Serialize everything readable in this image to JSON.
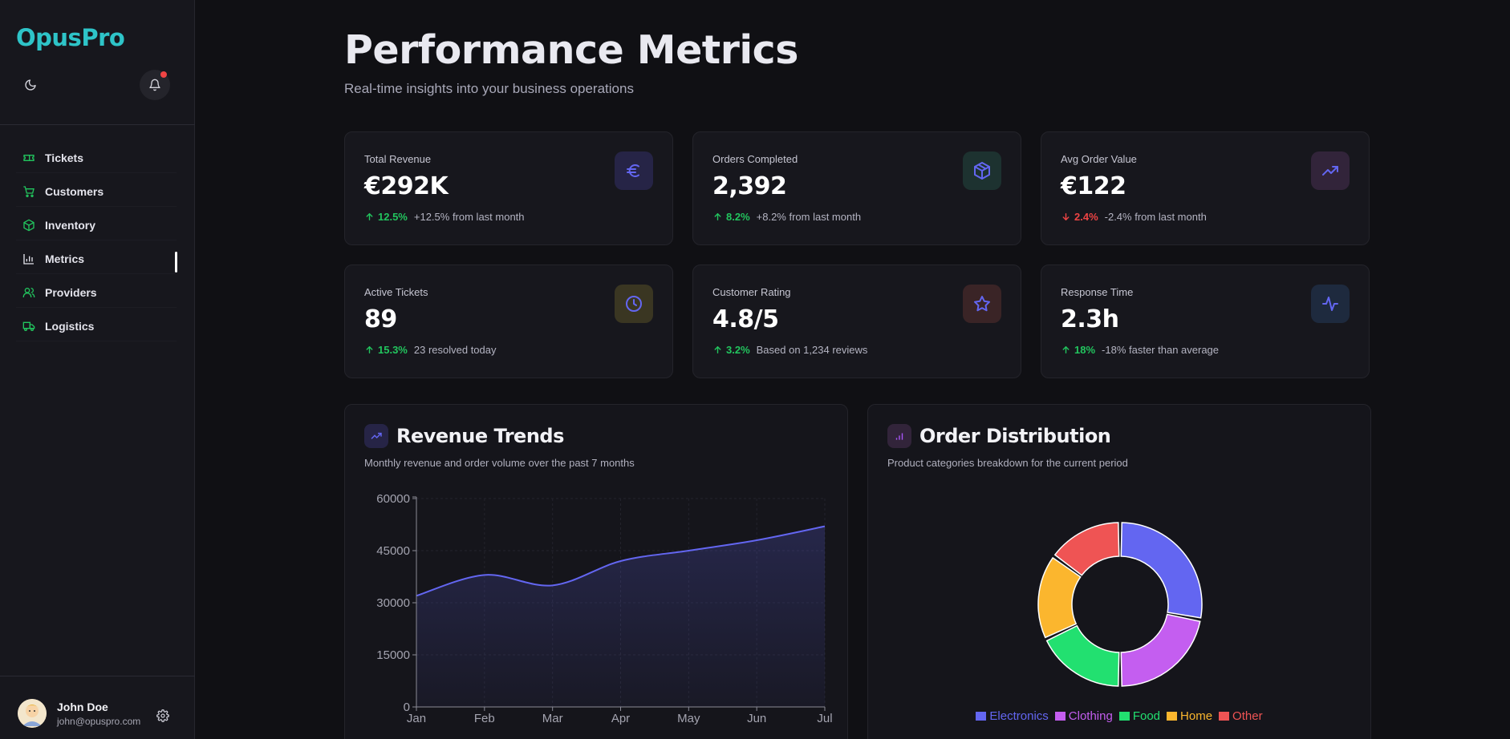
{
  "brand": "OpusPro",
  "nav": [
    {
      "label": "Tickets",
      "icon": "ticket-icon"
    },
    {
      "label": "Customers",
      "icon": "cart-icon"
    },
    {
      "label": "Inventory",
      "icon": "box-icon"
    },
    {
      "label": "Metrics",
      "icon": "bar-chart-icon",
      "active": true
    },
    {
      "label": "Providers",
      "icon": "users-icon"
    },
    {
      "label": "Logistics",
      "icon": "truck-icon"
    }
  ],
  "user": {
    "name": "John Doe",
    "email": "john@opuspro.com"
  },
  "header": {
    "title": "Performance Metrics",
    "subtitle": "Real-time insights into your business operations"
  },
  "cards": [
    {
      "label": "Total Revenue",
      "value": "€292K",
      "pct": "12.5%",
      "note": "+12.5% from last month",
      "trend": "up",
      "icon": "euro-icon",
      "icon_color": "#6366f1",
      "icon_bg": "#262446"
    },
    {
      "label": "Orders Completed",
      "value": "2,392",
      "pct": "8.2%",
      "note": "+8.2% from last month",
      "trend": "up",
      "icon": "package-icon",
      "icon_color": "#6366f1",
      "icon_bg": "#1d3230"
    },
    {
      "label": "Avg Order Value",
      "value": "€122",
      "pct": "2.4%",
      "note": "-2.4% from last month",
      "trend": "down",
      "icon": "trending-up-icon",
      "icon_color": "#6366f1",
      "icon_bg": "#32243a"
    },
    {
      "label": "Active Tickets",
      "value": "89",
      "pct": "15.3%",
      "note": "23 resolved today",
      "trend": "up",
      "icon": "clock-icon",
      "icon_color": "#6366f1",
      "icon_bg": "#3a3622"
    },
    {
      "label": "Customer Rating",
      "value": "4.8/5",
      "pct": "3.2%",
      "note": "Based on 1,234 reviews",
      "trend": "up",
      "icon": "star-icon",
      "icon_color": "#6366f1",
      "icon_bg": "#3a2426"
    },
    {
      "label": "Response Time",
      "value": "2.3h",
      "pct": "18%",
      "note": "-18% faster than average",
      "trend": "up",
      "icon": "activity-icon",
      "icon_color": "#6366f1",
      "icon_bg": "#1e2a3e"
    }
  ],
  "panels": {
    "revenue": {
      "title": "Revenue Trends",
      "subtitle": "Monthly revenue and order volume over the past 7 months"
    },
    "orders": {
      "title": "Order Distribution",
      "subtitle": "Product categories breakdown for the current period"
    }
  },
  "chart_data": [
    {
      "type": "area",
      "x": [
        "Jan",
        "Feb",
        "Mar",
        "Apr",
        "May",
        "Jun",
        "Jul"
      ],
      "series": [
        {
          "values": [
            32000,
            38000,
            35000,
            42000,
            45000,
            48000,
            52000
          ]
        }
      ],
      "yticks": [
        0,
        15000,
        30000,
        45000,
        60000
      ],
      "ylim": [
        0,
        60000
      ],
      "color": "#6366f1"
    },
    {
      "type": "pie",
      "donut": true,
      "categories": [
        "Electronics",
        "Clothing",
        "Food",
        "Home",
        "Other"
      ],
      "values": [
        28,
        22,
        18,
        17,
        15
      ],
      "colors": [
        "#6366f1",
        "#c45ef0",
        "#22e070",
        "#fbb62e",
        "#ef5454"
      ],
      "legend": "bottom"
    }
  ]
}
